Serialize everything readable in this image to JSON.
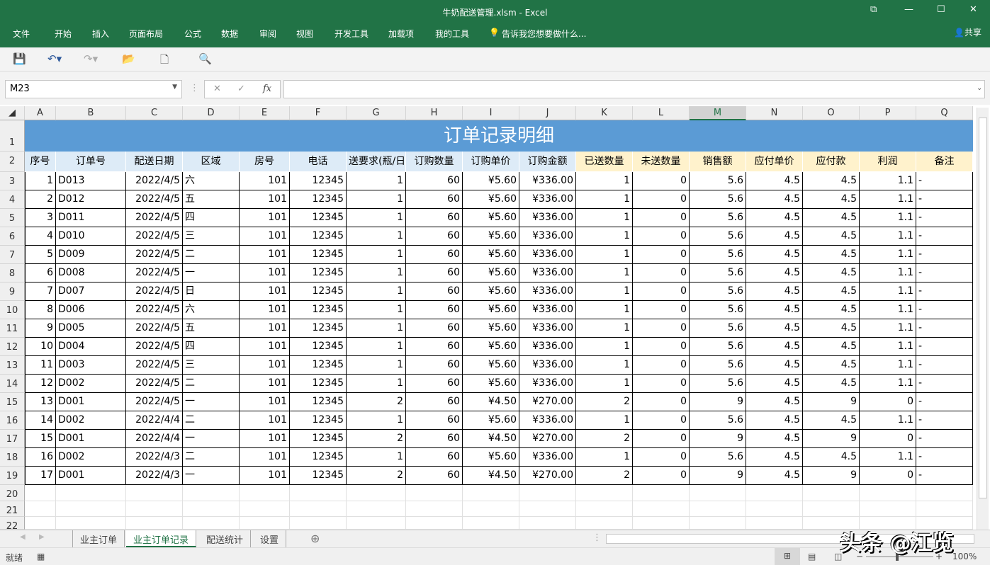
{
  "window": {
    "title": "牛奶配送管理.xlsm - Excel",
    "restore": "⧉",
    "minimize": "—",
    "maximize": "☐",
    "close": "✕"
  },
  "menu": {
    "items": [
      "文件",
      "开始",
      "插入",
      "页面布局",
      "公式",
      "数据",
      "审阅",
      "视图",
      "开发工具",
      "加载项",
      "我的工具"
    ],
    "tell_me": "告诉我您想要做什么...",
    "share": "共享"
  },
  "formula": {
    "name_box": "M23",
    "formula": "",
    "fx": "fx",
    "cancel": "✕",
    "enter": "✓"
  },
  "columns": [
    "A",
    "B",
    "C",
    "D",
    "E",
    "F",
    "G",
    "H",
    "I",
    "J",
    "K",
    "L",
    "M",
    "N",
    "O",
    "P",
    "Q"
  ],
  "selected_column": "M",
  "sheet": {
    "title": "订单记录明细",
    "headers": [
      "序号",
      "订单号",
      "配送日期",
      "区域",
      "房号",
      "电话",
      "送要求(瓶/日",
      "订购数量",
      "订购单价",
      "订购金额",
      "已送数量",
      "未送数量",
      "销售额",
      "应付单价",
      "应付款",
      "利润",
      "备注"
    ],
    "rows": [
      [
        "1",
        "D013",
        "2022/4/5",
        "六",
        "101",
        "12345",
        "1",
        "60",
        "¥5.60",
        "¥336.00",
        "1",
        "0",
        "5.6",
        "4.5",
        "4.5",
        "1.1",
        "-"
      ],
      [
        "2",
        "D012",
        "2022/4/5",
        "五",
        "101",
        "12345",
        "1",
        "60",
        "¥5.60",
        "¥336.00",
        "1",
        "0",
        "5.6",
        "4.5",
        "4.5",
        "1.1",
        "-"
      ],
      [
        "3",
        "D011",
        "2022/4/5",
        "四",
        "101",
        "12345",
        "1",
        "60",
        "¥5.60",
        "¥336.00",
        "1",
        "0",
        "5.6",
        "4.5",
        "4.5",
        "1.1",
        "-"
      ],
      [
        "4",
        "D010",
        "2022/4/5",
        "三",
        "101",
        "12345",
        "1",
        "60",
        "¥5.60",
        "¥336.00",
        "1",
        "0",
        "5.6",
        "4.5",
        "4.5",
        "1.1",
        "-"
      ],
      [
        "5",
        "D009",
        "2022/4/5",
        "二",
        "101",
        "12345",
        "1",
        "60",
        "¥5.60",
        "¥336.00",
        "1",
        "0",
        "5.6",
        "4.5",
        "4.5",
        "1.1",
        "-"
      ],
      [
        "6",
        "D008",
        "2022/4/5",
        "一",
        "101",
        "12345",
        "1",
        "60",
        "¥5.60",
        "¥336.00",
        "1",
        "0",
        "5.6",
        "4.5",
        "4.5",
        "1.1",
        "-"
      ],
      [
        "7",
        "D007",
        "2022/4/5",
        "日",
        "101",
        "12345",
        "1",
        "60",
        "¥5.60",
        "¥336.00",
        "1",
        "0",
        "5.6",
        "4.5",
        "4.5",
        "1.1",
        "-"
      ],
      [
        "8",
        "D006",
        "2022/4/5",
        "六",
        "101",
        "12345",
        "1",
        "60",
        "¥5.60",
        "¥336.00",
        "1",
        "0",
        "5.6",
        "4.5",
        "4.5",
        "1.1",
        "-"
      ],
      [
        "9",
        "D005",
        "2022/4/5",
        "五",
        "101",
        "12345",
        "1",
        "60",
        "¥5.60",
        "¥336.00",
        "1",
        "0",
        "5.6",
        "4.5",
        "4.5",
        "1.1",
        "-"
      ],
      [
        "10",
        "D004",
        "2022/4/5",
        "四",
        "101",
        "12345",
        "1",
        "60",
        "¥5.60",
        "¥336.00",
        "1",
        "0",
        "5.6",
        "4.5",
        "4.5",
        "1.1",
        "-"
      ],
      [
        "11",
        "D003",
        "2022/4/5",
        "三",
        "101",
        "12345",
        "1",
        "60",
        "¥5.60",
        "¥336.00",
        "1",
        "0",
        "5.6",
        "4.5",
        "4.5",
        "1.1",
        "-"
      ],
      [
        "12",
        "D002",
        "2022/4/5",
        "二",
        "101",
        "12345",
        "1",
        "60",
        "¥5.60",
        "¥336.00",
        "1",
        "0",
        "5.6",
        "4.5",
        "4.5",
        "1.1",
        "-"
      ],
      [
        "13",
        "D001",
        "2022/4/5",
        "一",
        "101",
        "12345",
        "2",
        "60",
        "¥4.50",
        "¥270.00",
        "2",
        "0",
        "9",
        "4.5",
        "9",
        "0",
        "-"
      ],
      [
        "14",
        "D002",
        "2022/4/4",
        "二",
        "101",
        "12345",
        "1",
        "60",
        "¥5.60",
        "¥336.00",
        "1",
        "0",
        "5.6",
        "4.5",
        "4.5",
        "1.1",
        "-"
      ],
      [
        "15",
        "D001",
        "2022/4/4",
        "一",
        "101",
        "12345",
        "2",
        "60",
        "¥4.50",
        "¥270.00",
        "2",
        "0",
        "9",
        "4.5",
        "9",
        "0",
        "-"
      ],
      [
        "16",
        "D002",
        "2022/4/3",
        "二",
        "101",
        "12345",
        "1",
        "60",
        "¥5.60",
        "¥336.00",
        "1",
        "0",
        "5.6",
        "4.5",
        "4.5",
        "1.1",
        "-"
      ],
      [
        "17",
        "D001",
        "2022/4/3",
        "一",
        "101",
        "12345",
        "2",
        "60",
        "¥4.50",
        "¥270.00",
        "2",
        "0",
        "9",
        "4.5",
        "9",
        "0",
        "-"
      ]
    ],
    "row_numbers": [
      "1",
      "2",
      "3",
      "4",
      "5",
      "6",
      "7",
      "8",
      "9",
      "10",
      "11",
      "12",
      "13",
      "14",
      "15",
      "16",
      "17",
      "18",
      "19",
      "20",
      "21",
      "22"
    ]
  },
  "colors": {
    "title_bg": "#5b9bd5",
    "header_blue": "#ddebf7",
    "header_yellow": "#fff2cc",
    "excel_green": "#217346"
  },
  "tabs": [
    "业主订单",
    "业主订单记录",
    "配送统计",
    "设置"
  ],
  "active_tab": "业主订单记录",
  "status": {
    "ready": "就绪",
    "zoom": "100%"
  },
  "watermark": "头条 @江览"
}
